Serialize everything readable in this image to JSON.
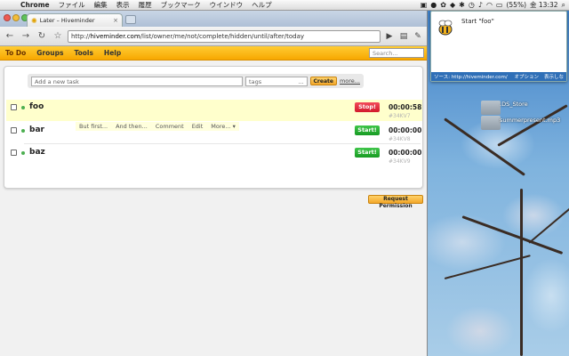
{
  "menubar": {
    "app": "Chrome",
    "items": [
      "ファイル",
      "編集",
      "表示",
      "履歴",
      "ブックマーク",
      "ウインドウ",
      "ヘルプ"
    ],
    "battery": "(55%)",
    "clock": "金 13:32"
  },
  "browser": {
    "tab_title": "Later – Hiveminder",
    "url_host": "hiveminder.com",
    "url_prefix": "http://",
    "url_path": "/list/owner/me/not/complete/hidden/until/after/today"
  },
  "hiveminder": {
    "nav": [
      "To Do",
      "Groups",
      "Tools",
      "Help"
    ],
    "search_placeholder": "Search...",
    "add_placeholder": "Add a new task",
    "tags_placeholder": "tags",
    "tags_more": "...",
    "create_label": "Create",
    "more_label": "more...",
    "tasks": [
      {
        "title": "foo",
        "button": "Stop!",
        "timer": "00:00:58",
        "rid": "#34KV7"
      },
      {
        "title": "bar",
        "button": "Start!",
        "timer": "00:00:00",
        "rid": "#34KV8"
      },
      {
        "title": "baz",
        "button": "Start!",
        "timer": "00:00:00",
        "rid": "#34KV9"
      }
    ],
    "task_actions": [
      "But first...",
      "And then...",
      "Comment",
      "Edit",
      "More... ▾"
    ],
    "request_permission": "Request Permission"
  },
  "growl": {
    "title": "Start \"foo\"",
    "source": "ソース: http://hiveminder.com/",
    "options": "オプション",
    "dismiss": "表示しな"
  },
  "desktop": {
    "file1": ".DS_Store",
    "file2": "summerpresent.mp3"
  },
  "colors": {
    "nav_yellow": "#f7a700",
    "stop_red": "#d11a2b",
    "start_green": "#179a22",
    "highlight": "#ffffcc"
  }
}
